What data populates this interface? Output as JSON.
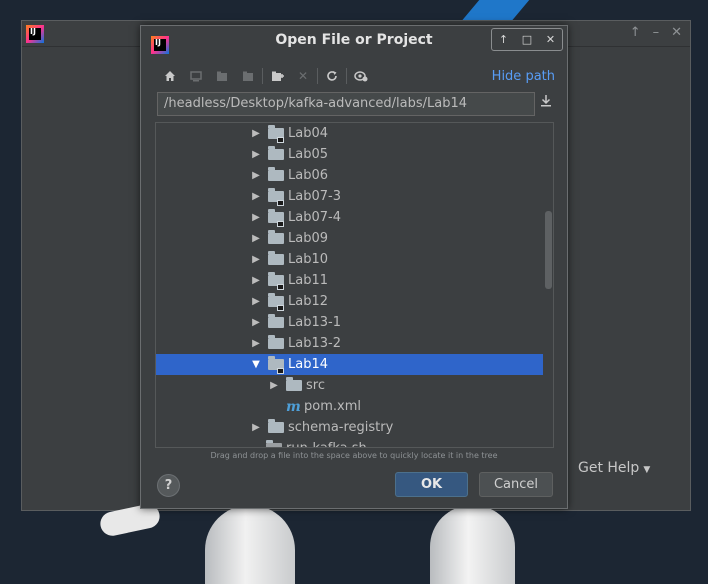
{
  "dialog": {
    "title": "Open File or Project",
    "hide_path_label": "Hide path",
    "path_value": "/headless/Desktop/kafka-advanced/labs/Lab14",
    "hint": "Drag and drop a file into the space above to quickly locate it in the tree",
    "help_label": "?",
    "ok_label": "OK",
    "cancel_label": "Cancel",
    "window_controls": [
      "↑",
      "□",
      "✕"
    ],
    "toolbar_icons": [
      "home-icon",
      "desktop-icon",
      "project-folder-icon",
      "module-folder-icon",
      "new-folder-icon",
      "delete-icon",
      "refresh-icon",
      "show-hidden-icon"
    ]
  },
  "tree": {
    "rows": [
      {
        "label": "Lab04",
        "arrow": "▶",
        "icon": "folder-module-icon",
        "indent": 1
      },
      {
        "label": "Lab05",
        "arrow": "▶",
        "icon": "folder-icon",
        "indent": 1
      },
      {
        "label": "Lab06",
        "arrow": "▶",
        "icon": "folder-icon",
        "indent": 1
      },
      {
        "label": "Lab07-3",
        "arrow": "▶",
        "icon": "folder-module-icon",
        "indent": 1
      },
      {
        "label": "Lab07-4",
        "arrow": "▶",
        "icon": "folder-module-icon",
        "indent": 1
      },
      {
        "label": "Lab09",
        "arrow": "▶",
        "icon": "folder-icon",
        "indent": 1
      },
      {
        "label": "Lab10",
        "arrow": "▶",
        "icon": "folder-icon",
        "indent": 1
      },
      {
        "label": "Lab11",
        "arrow": "▶",
        "icon": "folder-module-icon",
        "indent": 1
      },
      {
        "label": "Lab12",
        "arrow": "▶",
        "icon": "folder-module-icon",
        "indent": 1
      },
      {
        "label": "Lab13-1",
        "arrow": "▶",
        "icon": "folder-icon",
        "indent": 1
      },
      {
        "label": "Lab13-2",
        "arrow": "▶",
        "icon": "folder-icon",
        "indent": 1
      },
      {
        "label": "Lab14",
        "arrow": "▼",
        "icon": "folder-module-icon",
        "indent": 1,
        "selected": true
      },
      {
        "label": "src",
        "arrow": "▶",
        "icon": "folder-icon",
        "indent": 2
      },
      {
        "label": "pom.xml",
        "arrow": "",
        "icon": "maven-icon",
        "indent": 2
      },
      {
        "label": "schema-registry",
        "arrow": "▶",
        "icon": "folder-icon",
        "indent": 1
      },
      {
        "label": "run-kafka.sh",
        "arrow": "",
        "icon": "file-icon",
        "indent": 0
      }
    ]
  },
  "background_window": {
    "get_help_label": "Get Help",
    "partial_text": "e",
    "controls": [
      "↑",
      "–",
      "✕"
    ]
  }
}
